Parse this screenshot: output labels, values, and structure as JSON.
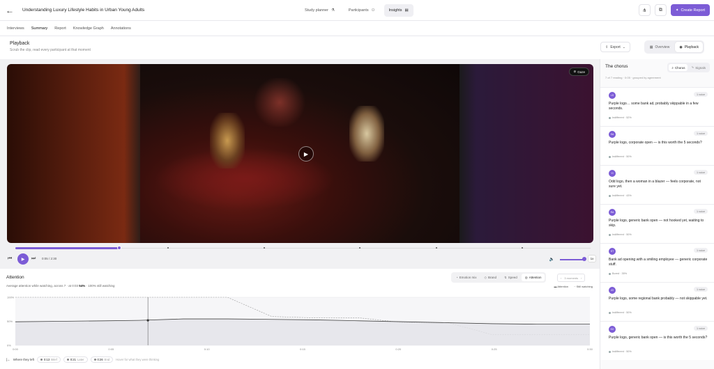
{
  "topbar": {
    "title": "Understanding Luxury Lifestyle Habits in Urban Young Adults",
    "nav": [
      {
        "label": "Study planner",
        "icon": "flask-icon"
      },
      {
        "label": "Participants",
        "icon": "users-icon"
      },
      {
        "label": "Insights",
        "icon": "chart-icon",
        "active": true
      }
    ],
    "create_label": "Create Report"
  },
  "subnav": [
    "Interviews",
    "Summary",
    "Report",
    "Knowledge Graph",
    "Annotations"
  ],
  "subnav_active": "Summary",
  "header": {
    "title": "Playback",
    "subtitle": "Scrub the clip, read every participant at that moment",
    "export_label": "Export",
    "modes": [
      {
        "label": "Overview"
      },
      {
        "label": "Playback",
        "active": true
      }
    ]
  },
  "video": {
    "gaze_label": "Gaze",
    "progress": 0.18,
    "time": "0:05 / 2:30",
    "volume": 0.85,
    "speed": "1x"
  },
  "attention": {
    "title": "Attention",
    "subtitle_pre": "Average attention while watching, across 7 · at 0:03 ",
    "subtitle_value": "54%",
    "subtitle_post": " · 100% still watching",
    "lenses": [
      {
        "label": "Emotion mix"
      },
      {
        "label": "Brand"
      },
      {
        "label": "Speed"
      },
      {
        "label": "Attention",
        "active": true
      }
    ],
    "moments_label": "3 moments",
    "legend": [
      "Attention",
      "Still watching"
    ],
    "where_label": "Where they left",
    "where_pills": [
      {
        "time": "0:13",
        "label": "Brief"
      },
      {
        "time": "0:21",
        "label": "Later"
      },
      {
        "time": "0:26",
        "label": "End"
      }
    ],
    "hint": "Hover for what they were thinking"
  },
  "chart_data": {
    "type": "line",
    "x": [
      0,
      10,
      20,
      28,
      38,
      48,
      58,
      68,
      78,
      88,
      98,
      108,
      118,
      130
    ],
    "series": [
      {
        "name": "Attention",
        "values": [
          49,
          50,
          51,
          52,
          55,
          55,
          54,
          53,
          51,
          49,
          47,
          45,
          44,
          44
        ]
      },
      {
        "name": "Still watching",
        "values": [
          100,
          100,
          100,
          100,
          100,
          100,
          60,
          57,
          57,
          47,
          47,
          22,
          22,
          22
        ]
      }
    ],
    "x_ticks": [
      "0:00",
      "0:05",
      "0:10",
      "0:15",
      "0:20",
      "0:25",
      "0:30"
    ],
    "y_ticks": [
      "100%",
      "50%",
      "0%"
    ],
    "ylim": [
      0,
      100
    ]
  },
  "sidebar": {
    "title": "The chorus",
    "subtitle": "7 of 7 reading · 0:05 · grouped by agreement",
    "toggle": [
      {
        "label": "Chorus",
        "active": true
      },
      {
        "label": "Signals"
      }
    ],
    "cards": [
      {
        "initials": "LS",
        "voice": "1 voice",
        "quote": "Purple logo… some bank ad, probably skippable in a few seconds.",
        "meta": "Indifferent · 52%"
      },
      {
        "initials": "SA",
        "voice": "1 voice",
        "quote": "Purple logo, corporate open — is this worth the 5 seconds?",
        "meta": "Indifferent · 50%"
      },
      {
        "initials": "YI",
        "voice": "1 voice",
        "quote": "Odd logo, then a woman in a blazer — feels corporate, not sure yet.",
        "meta": "Indifferent · 43%"
      },
      {
        "initials": "RA",
        "voice": "1 voice",
        "quote": "Purple logo, generic bank open — not hooked yet, waiting to skip.",
        "meta": "Indifferent · 50%"
      },
      {
        "initials": "ST",
        "voice": "1 voice",
        "quote": "Bank ad opening with a smiling employee — generic corporate stuff.",
        "meta": "Bored · 35%"
      },
      {
        "initials": "JO",
        "voice": "1 voice",
        "quote": "Purple logo, some regional bank probably — not skippable yet.",
        "meta": "Indifferent · 50%"
      },
      {
        "initials": "SO",
        "voice": "1 voice",
        "quote": "Purple logo, generic bank open — is this worth the 5 seconds?",
        "meta": "Indifferent · 50%"
      }
    ]
  },
  "colors": {
    "accent": "#7c5cd6"
  }
}
